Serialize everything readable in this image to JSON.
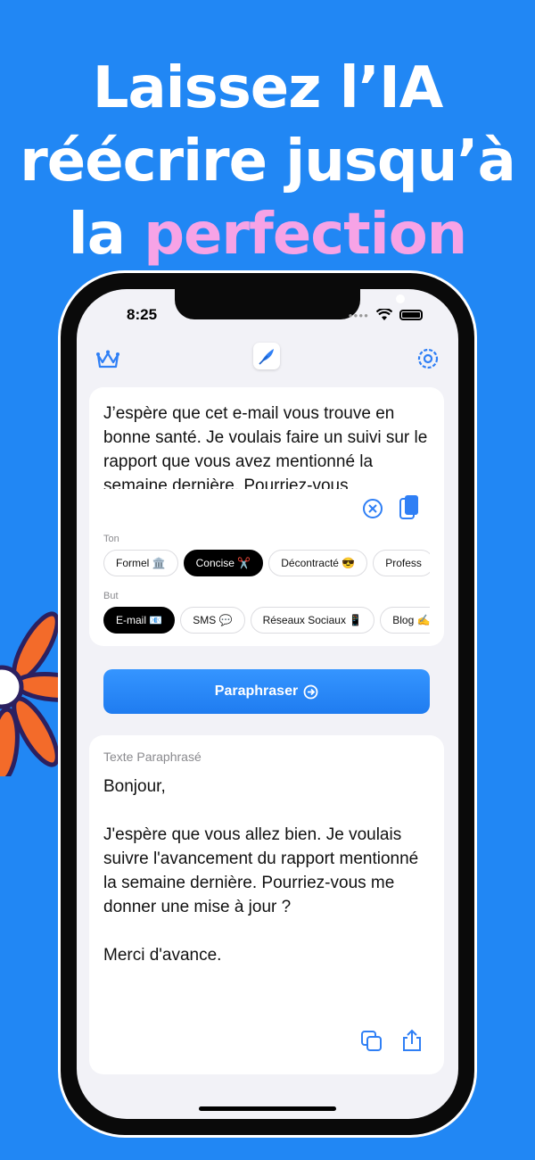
{
  "headline": {
    "line1": "Laissez l’IA",
    "line2": "réécrire jusqu’à",
    "line3_prefix": "la ",
    "line3_accent": "perfection"
  },
  "colors": {
    "background": "#2187f4",
    "accent_text": "#f7a3e6",
    "app_blue": "#2f7ff5",
    "flower": "#f36b2a"
  },
  "status_bar": {
    "time": "8:25"
  },
  "icons": {
    "left": "crown-icon",
    "center": "feather-icon",
    "right": "gear-icon"
  },
  "input": {
    "text": "J’espère que cet e-mail vous trouve en bonne santé. Je voulais faire un suivi sur le rapport que vous avez mentionné la semaine dernière. Pourriez-vous"
  },
  "tone": {
    "label": "Ton",
    "chips": [
      "Formel 🏛️",
      "Concise ✂️",
      "Décontracté 😎",
      "Profess"
    ],
    "selected_index": 1
  },
  "purpose": {
    "label": "But",
    "chips": [
      "E-mail 📧",
      "SMS 💬",
      "Réseaux Sociaux 📱",
      "Blog ✍️"
    ],
    "selected_index": 0
  },
  "cta": {
    "label": "Paraphraser"
  },
  "output": {
    "label": "Texte Paraphrasé",
    "text": "Bonjour,\n\nJ'espère que vous allez bien. Je voulais suivre l'avancement du rapport mentionné la semaine dernière. Pourriez-vous me donner une mise à jour ?\n\nMerci d'avance."
  }
}
